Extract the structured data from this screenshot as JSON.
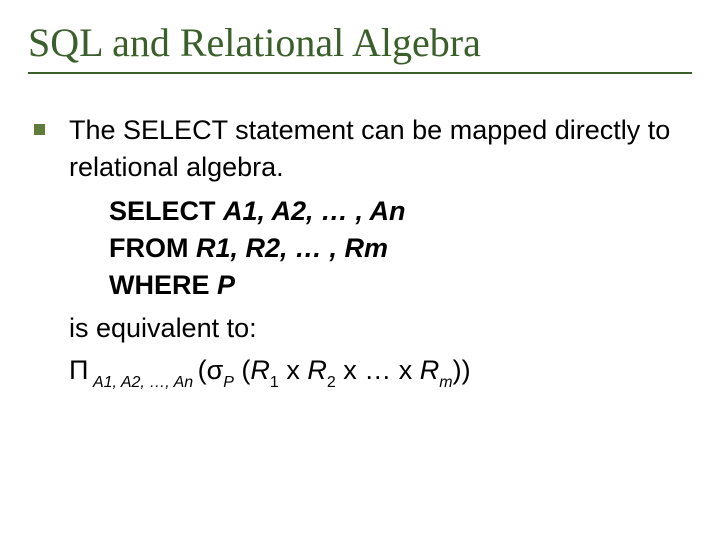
{
  "title": "SQL and Relational Algebra",
  "intro": "The SELECT statement can be mapped directly to relational algebra.",
  "sql": {
    "select_kw": "SELECT ",
    "select_args": "A1, A2, … , An",
    "from_kw": "FROM ",
    "from_args": "R1, R2, … , Rm",
    "where_kw": "WHERE ",
    "where_arg": "P"
  },
  "equiv": "is equivalent to:",
  "formula": {
    "pi": "Π",
    "pi_sub": " A1, A2, …, An ",
    "open1": "(σ",
    "sigma_sub": "P",
    "open2": " (",
    "r": "R",
    "s1": "1",
    "x": " x ",
    "s2": "2",
    "xdots": " x … x ",
    "sm": "m",
    "close": "))"
  }
}
